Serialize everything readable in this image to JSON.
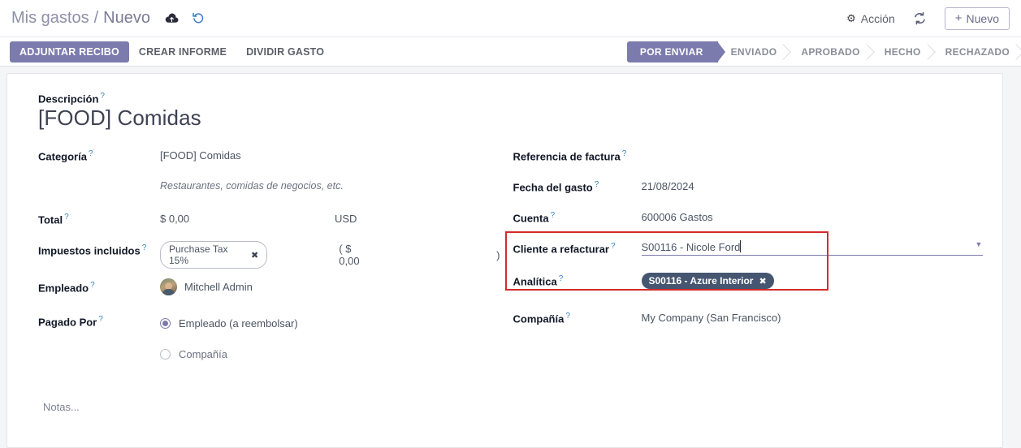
{
  "breadcrumb": {
    "parent": "Mis gastos",
    "separator": "/",
    "current": "Nuevo",
    "save_icon": "cloud-upload-icon",
    "discard_icon": "undo-icon"
  },
  "topbar": {
    "action_label": "Acción",
    "action_icon": "gear-icon",
    "reload_icon": "refresh-icon",
    "new_label": "Nuevo",
    "new_plus": "+"
  },
  "buttons": {
    "attach_receipt": "ADJUNTAR RECIBO",
    "create_report": "CREAR INFORME",
    "split_expense": "DIVIDIR GASTO"
  },
  "statusbar": {
    "stages": [
      {
        "label": "POR ENVIAR",
        "active": true
      },
      {
        "label": "ENVIADO",
        "active": false
      },
      {
        "label": "APROBADO",
        "active": false
      },
      {
        "label": "HECHO",
        "active": false
      },
      {
        "label": "RECHAZADO",
        "active": false
      }
    ]
  },
  "form": {
    "tooltip_marker": "?",
    "description": {
      "label": "Descripción",
      "value": "[FOOD] Comidas"
    },
    "left": {
      "category": {
        "label": "Categoría",
        "value": "[FOOD] Comidas",
        "hint": "Restaurantes, comidas de negocios, etc."
      },
      "total": {
        "label": "Total",
        "amount": "$ 0,00",
        "currency": "USD"
      },
      "taxes": {
        "label": "Impuestos incluidos",
        "tag": "Purchase Tax 15%",
        "tag_remove": "✖",
        "open_paren": "( $ 0,00",
        "close_paren": ")"
      },
      "employee": {
        "label": "Empleado",
        "value": "Mitchell Admin",
        "avatar": "user-avatar"
      },
      "paid_by": {
        "label": "Pagado Por",
        "options": [
          {
            "label": "Empleado (a reembolsar)",
            "selected": true
          },
          {
            "label": "Compañía",
            "selected": false
          }
        ]
      }
    },
    "right": {
      "bill_reference": {
        "label": "Referencia de factura",
        "value": ""
      },
      "expense_date": {
        "label": "Fecha del gasto",
        "value": "21/08/2024"
      },
      "account": {
        "label": "Cuenta",
        "value": "600006 Gastos"
      },
      "customer_to_reinvoice": {
        "label": "Cliente a refacturar",
        "value": "S00116 - Nicole Ford",
        "dropdown_icon": "chevron-down-icon",
        "focused": true
      },
      "analytic": {
        "label": "Analítica",
        "tag": "S00116 - Azure Interior",
        "tag_remove": "✖"
      },
      "company": {
        "label": "Compañía",
        "value": "My Company (San Francisco)"
      }
    },
    "notes_placeholder": "Notas..."
  },
  "colors": {
    "brand_purple": "#7c7bad",
    "highlight_border": "#d42b2b",
    "tag_dark": "#465671",
    "page_bg": "#f4f5f7"
  }
}
